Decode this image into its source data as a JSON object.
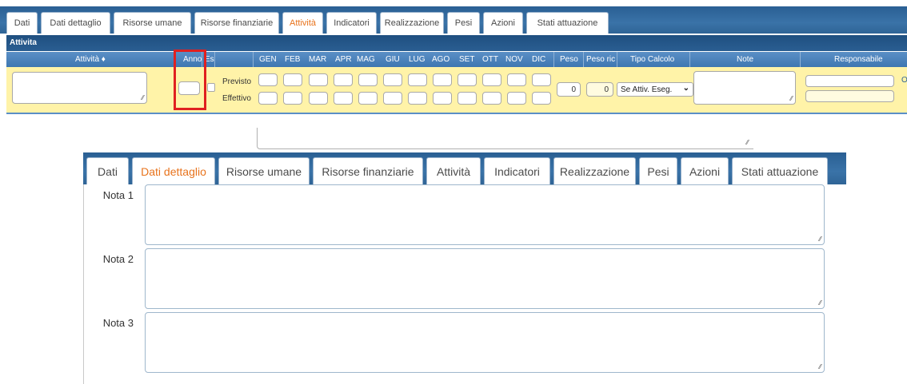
{
  "tabs_top": [
    "Dati",
    "Dati dettaglio",
    "Risorse umane",
    "Risorse finanziarie",
    "Attività",
    "Indicatori",
    "Realizzazione",
    "Pesi",
    "Azioni",
    "Stati attuazione"
  ],
  "tabs_top_active": "Attività",
  "section_title": "Attivita",
  "columns": {
    "attivita": "Attività ♦",
    "anno": "Anno",
    "es": "Es",
    "months": [
      "GEN",
      "FEB",
      "MAR",
      "APR",
      "MAG",
      "GIU",
      "LUG",
      "AGO",
      "SET",
      "OTT",
      "NOV",
      "DIC"
    ],
    "peso": "Peso",
    "peso_ric": "Peso ric",
    "tipo_calcolo": "Tipo Calcolo",
    "note": "Note",
    "responsabile": "Responsabile"
  },
  "row": {
    "previsto_label": "Previsto",
    "effettivo_label": "Effettivo",
    "peso_value": "0",
    "peso_ric_value": "0",
    "tipo_calcolo_value": "Se Attiv. Eseg.",
    "resp_button": "O"
  },
  "tabs_bottom": [
    "Dati",
    "Dati dettaglio",
    "Risorse umane",
    "Risorse finanziarie",
    "Attività",
    "Indicatori",
    "Realizzazione",
    "Pesi",
    "Azioni",
    "Stati attuazione"
  ],
  "tabs_bottom_active": "Dati dettaglio",
  "notes": [
    "Nota 1",
    "Nota 2",
    "Nota 3"
  ],
  "colors": {
    "tab_bar": "#2f6496",
    "active_tab_text": "#e8731c",
    "row_bg": "#fff3a8",
    "highlight": "#e02020"
  },
  "icons": [
    "sort-icon",
    "resize-grip-icon",
    "chevron-down-icon"
  ]
}
